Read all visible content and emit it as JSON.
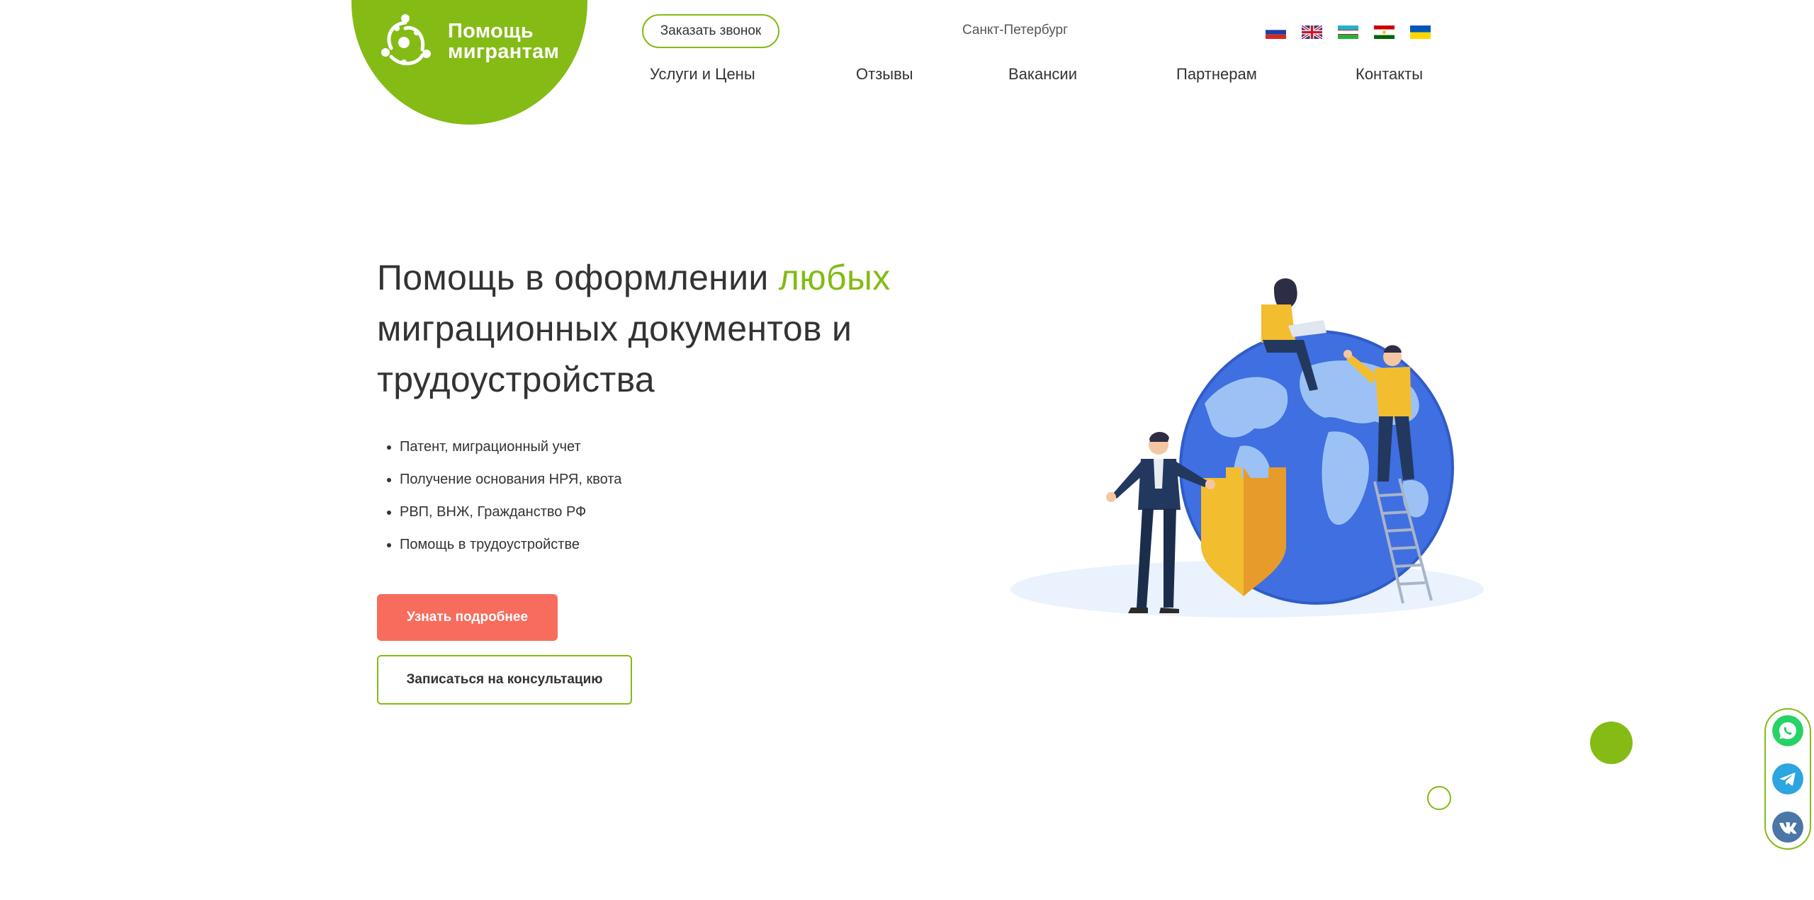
{
  "brand": {
    "logo_line1": "Помощь",
    "logo_line2": "мигрантам",
    "accent_color": "#84bb15",
    "cta_color": "#f86c5d"
  },
  "header": {
    "callback_label": "Заказать звонок",
    "city": "Санкт-Петербург",
    "languages": [
      "russia-flag-icon",
      "uk-flag-icon",
      "uzbekistan-flag-icon",
      "tajikistan-flag-icon",
      "ukraine-flag-icon"
    ]
  },
  "nav": {
    "items": [
      "Услуги и Цены",
      "Отзывы",
      "Вакансии",
      "Партнерам",
      "Контакты"
    ]
  },
  "hero": {
    "title_part1": "Помощь в оформлении ",
    "title_accent": "любых",
    "title_part2": "миграционных документов и трудоустройства",
    "features": [
      "Патент, миграционный учет",
      "Получение основания НРЯ, квота",
      "РВП, ВНЖ, Гражданство РФ",
      "Помощь в трудоустройстве"
    ],
    "primary_button": "Узнать подробнее",
    "secondary_button": "Записаться на консультацию"
  },
  "social": {
    "items": [
      "whatsapp-icon",
      "telegram-icon",
      "vk-icon"
    ],
    "colors": {
      "whatsapp": "#25d366",
      "telegram": "#2ca5e0",
      "vk": "#4a76a8"
    }
  }
}
